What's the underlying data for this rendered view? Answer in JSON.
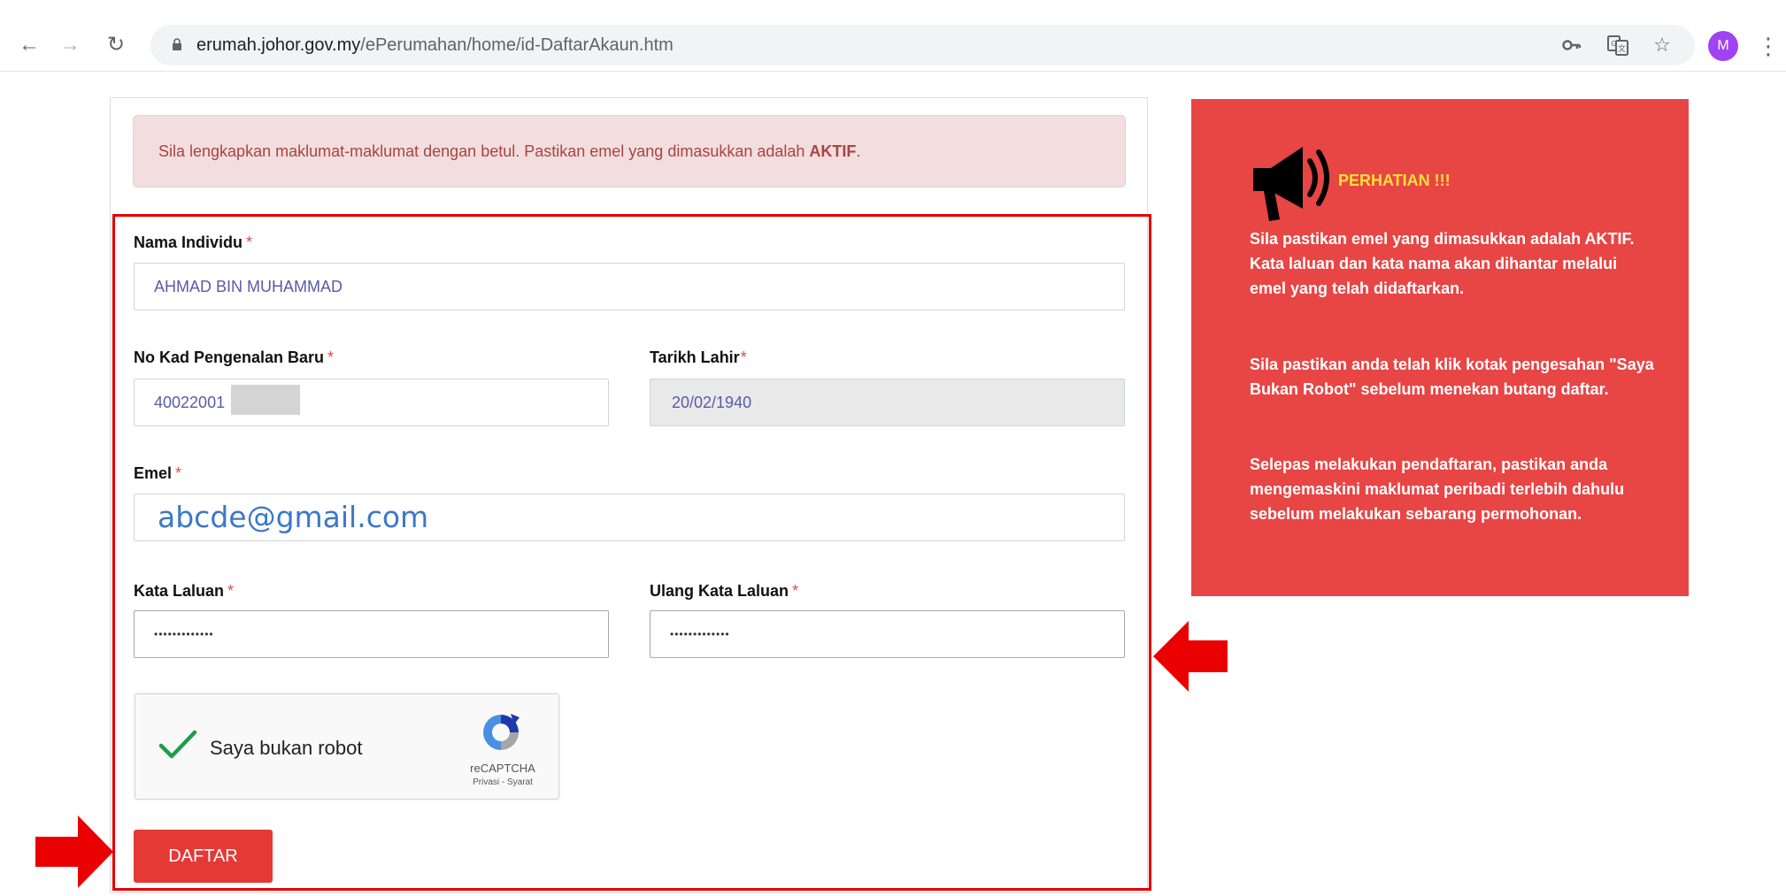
{
  "browser": {
    "url_domain": "erumah.johor.gov.my",
    "url_path": "/ePerumahan/home/id-DaftarAkaun.htm",
    "profile_initial": "M"
  },
  "alert": {
    "text": "Sila lengkapkan maklumat-maklumat dengan betul. Pastikan emel yang dimasukkan adalah ",
    "emphasis": "AKTIF",
    "suffix": "."
  },
  "form": {
    "nama": {
      "label": "Nama Individu",
      "required": "*",
      "value": "AHMAD BIN MUHAMMAD"
    },
    "ic": {
      "label": "No Kad Pengenalan Baru",
      "required": "*",
      "value": "40022001"
    },
    "dob": {
      "label": "Tarikh Lahir",
      "required": "*",
      "value": "20/02/1940"
    },
    "emel": {
      "label": "Emel",
      "required": "*",
      "value": "abcde@gmail.com"
    },
    "password": {
      "label": "Kata Laluan",
      "required": "*",
      "value": "•••••••••••••"
    },
    "password_confirm": {
      "label": "Ulang Kata Laluan",
      "required": "*",
      "value": "•••••••••••••"
    },
    "captcha": {
      "label": "Saya bukan robot",
      "brand": "reCAPTCHA",
      "links": "Privasi - Syarat"
    },
    "submit_label": "DAFTAR"
  },
  "notice": {
    "title": "PERHATIAN !!!",
    "p1": "Sila pastikan emel yang dimasukkan adalah AKTIF. Kata laluan dan kata nama akan dihantar melalui emel yang telah didaftarkan.",
    "p2": "Sila pastikan anda telah klik kotak pengesahan \"Saya Bukan Robot\" sebelum menekan butang daftar.",
    "p3": "Selepas melakukan pendaftaran, pastikan anda mengemaskini maklumat peribadi terlebih dahulu sebelum melakukan sebarang permohonan."
  },
  "colors": {
    "highlight_box": "#e20000",
    "button": "#e53935",
    "notice_bg": "#e84545",
    "notice_title": "#ffe03a"
  }
}
